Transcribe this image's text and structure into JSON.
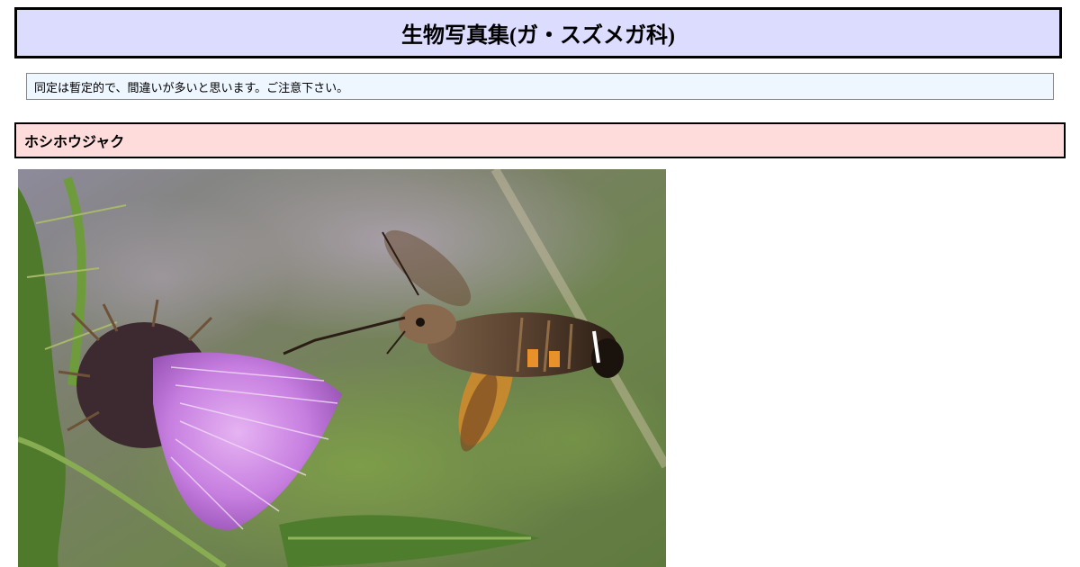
{
  "header": {
    "title": "生物写真集(ガ・スズメガ科)"
  },
  "notice": {
    "text": "同定は暫定的で、間違いが多いと思います。ご注意下さい。"
  },
  "section": {
    "species_name": "ホシホウジャク"
  },
  "colors": {
    "title_bg": "#dcdcff",
    "notice_bg": "#eef6ff",
    "section_bg": "#ffdcdc"
  }
}
